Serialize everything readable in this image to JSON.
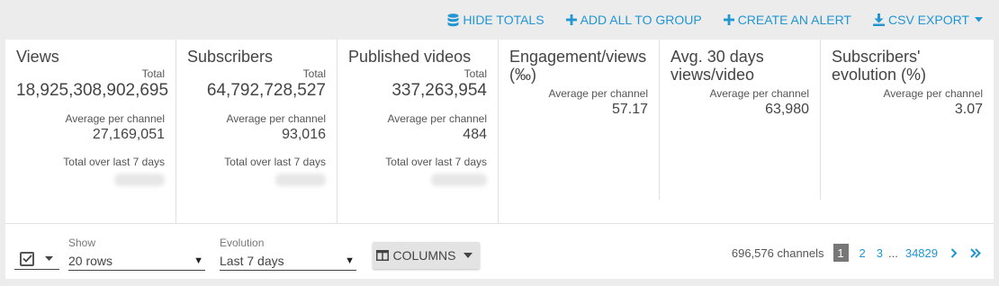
{
  "toolbar": {
    "hide_totals": "HIDE TOTALS",
    "add_to_group": "ADD ALL TO GROUP",
    "create_alert": "CREATE AN ALERT",
    "csv_export": "CSV EXPORT"
  },
  "stats": {
    "views": {
      "title": "Views",
      "total_label": "Total",
      "total": "18,925,308,902,695",
      "avg_label": "Average per channel",
      "avg": "27,169,051",
      "last7_label": "Total over last 7 days"
    },
    "subscribers": {
      "title": "Subscribers",
      "total_label": "Total",
      "total": "64,792,728,527",
      "avg_label": "Average per channel",
      "avg": "93,016",
      "last7_label": "Total over last 7 days"
    },
    "published": {
      "title": "Published videos",
      "total_label": "Total",
      "total": "337,263,954",
      "avg_label": "Average per channel",
      "avg": "484",
      "last7_label": "Total over last 7 days"
    },
    "engagement": {
      "title": "Engagement/views (‰)",
      "avg_label": "Average per channel",
      "avg": "57.17"
    },
    "avg30": {
      "title": "Avg. 30 days views/video",
      "avg_label": "Average per channel",
      "avg": "63,980"
    },
    "subs_evolution": {
      "title": "Subscribers' evolution (%)",
      "avg_label": "Average per channel",
      "avg": "3.07"
    }
  },
  "controls": {
    "show_label": "Show",
    "show_value": "20 rows",
    "evolution_label": "Evolution",
    "evolution_value": "Last 7 days",
    "columns_label": "COLUMNS"
  },
  "pager": {
    "count": "696,576 channels",
    "current": "1",
    "page2": "2",
    "page3": "3",
    "dots": "...",
    "last": "34829"
  },
  "colors": {
    "accent": "#2196d3",
    "background": "#ececec",
    "panel": "#ffffff"
  }
}
